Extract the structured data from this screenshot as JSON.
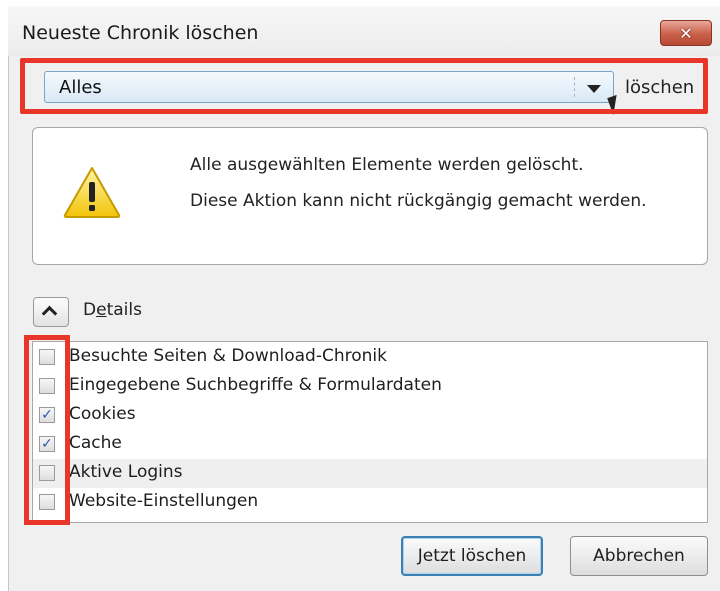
{
  "dialog": {
    "title": "Neueste Chronik löschen",
    "close_glyph": "✕"
  },
  "time_range": {
    "selected": "Alles",
    "label": "löschen"
  },
  "warning": {
    "line1": "Alle ausgewählten Elemente werden gelöscht.",
    "line2": "Diese Aktion kann nicht rückgängig gemacht werden.",
    "icon": "warning-icon"
  },
  "details": {
    "label_prefix": "D",
    "label_access": "e",
    "label_suffix": "tails",
    "expanded": true
  },
  "items": [
    {
      "label": "Besuchte Seiten & Download-Chronik",
      "checked": false
    },
    {
      "label": "Eingegebene Suchbegriffe & Formulardaten",
      "checked": false
    },
    {
      "label": "Cookies",
      "checked": true
    },
    {
      "label": "Cache",
      "checked": true
    },
    {
      "label": "Aktive Logins",
      "checked": false
    },
    {
      "label": "Website-Einstellungen",
      "checked": false
    }
  ],
  "buttons": {
    "confirm": "Jetzt löschen",
    "cancel": "Abbrechen"
  },
  "colors": {
    "highlight": "#e8372a",
    "close_button": "#c9604a",
    "check": "#2a57a8"
  }
}
